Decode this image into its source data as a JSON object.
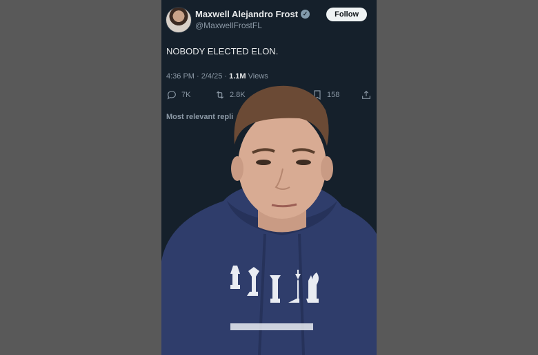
{
  "tweet": {
    "author_name": "Maxwell Alejandro Frost",
    "handle": "@MaxwellFrostFL",
    "follow_label": "Follow",
    "text": "NOBODY ELECTED ELON.",
    "time": "4:36 PM · 2/4/25 · ",
    "views_count": "1.1M",
    "views_label": " Views",
    "replies": "7K",
    "reposts": "2.8K",
    "bookmarks": "158",
    "replies_sort_label": "Most relevant repli"
  },
  "colors": {
    "background": "#15202b",
    "text": "#e7e9ea",
    "muted": "#8b98a5",
    "hoodie": "#2f3d6b"
  },
  "icons": [
    "verified-badge-icon",
    "reply-icon",
    "repost-icon",
    "bookmark-icon",
    "share-icon"
  ]
}
